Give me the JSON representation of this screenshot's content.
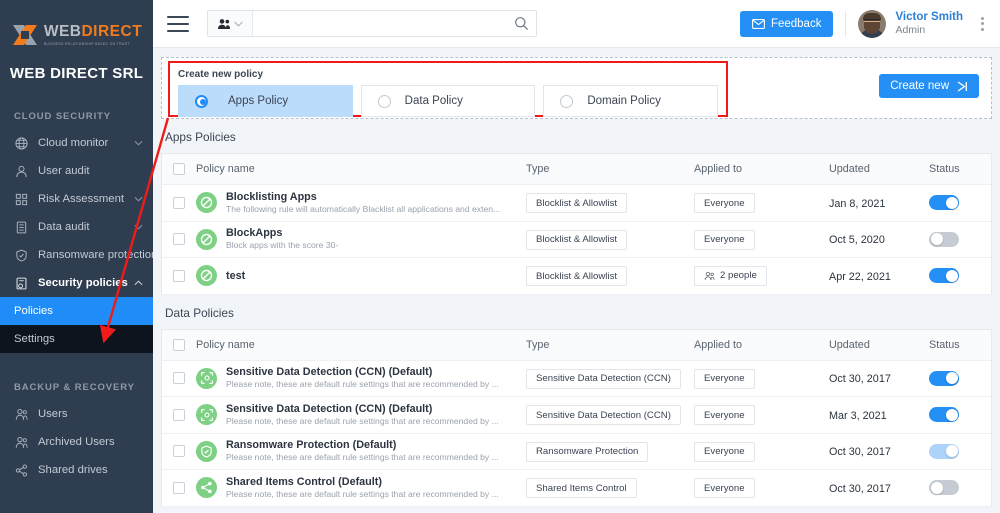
{
  "brand": {
    "logo_web": "WEB",
    "logo_direct": "DIRECT",
    "logo_tagline": "BUSINESS RELATIONSHIP BASED ON TRUST",
    "org_name": "WEB DIRECT SRL"
  },
  "sidebar": {
    "sections": [
      {
        "title": "CLOUD SECURITY",
        "items": [
          {
            "label": "Cloud monitor",
            "icon": "globe-icon",
            "chevron": "down",
            "state": "normal"
          },
          {
            "label": "User audit",
            "icon": "user-icon",
            "chevron": "",
            "state": "normal"
          },
          {
            "label": "Risk Assessment",
            "icon": "grid-icon",
            "chevron": "down",
            "state": "normal"
          },
          {
            "label": "Data audit",
            "icon": "database-icon",
            "chevron": "down",
            "state": "normal"
          },
          {
            "label": "Ransomware protection",
            "icon": "shield-icon",
            "chevron": "",
            "state": "normal"
          },
          {
            "label": "Security policies",
            "icon": "policy-icon",
            "chevron": "up",
            "state": "expanded"
          },
          {
            "label": "Policies",
            "icon": "",
            "chevron": "",
            "state": "selected"
          },
          {
            "label": "Settings",
            "icon": "",
            "chevron": "",
            "state": "subdark"
          }
        ]
      },
      {
        "title": "BACKUP & RECOVERY",
        "items": [
          {
            "label": "Users",
            "icon": "users-icon",
            "chevron": "",
            "state": "normal"
          },
          {
            "label": "Archived Users",
            "icon": "users-icon",
            "chevron": "",
            "state": "normal"
          },
          {
            "label": "Shared drives",
            "icon": "share-icon",
            "chevron": "",
            "state": "normal"
          }
        ]
      }
    ]
  },
  "topbar": {
    "menu_icon": "hamburger-icon",
    "search_scope_icon": "people-icon",
    "search_value": "",
    "search_placeholder": "",
    "search_icon": "search-icon",
    "feedback_label": "Feedback",
    "feedback_icon": "envelope-icon",
    "user_name": "Victor Smith",
    "user_role": "Admin",
    "overflow_icon": "kebab-menu-icon"
  },
  "create_panel": {
    "title": "Create new policy",
    "options": [
      {
        "label": "Apps Policy",
        "selected": true
      },
      {
        "label": "Data Policy",
        "selected": false
      },
      {
        "label": "Domain Policy",
        "selected": false
      }
    ],
    "create_button_label": "Create new",
    "create_button_icon": "arrow-right-icon",
    "highlight_color": "#ee1c19",
    "accent_color": "#2490f5"
  },
  "columns": {
    "policy_name": "Policy name",
    "type": "Type",
    "applied_to": "Applied to",
    "updated": "Updated",
    "status": "Status"
  },
  "apps_policies": {
    "section_title": "Apps Policies",
    "rows": [
      {
        "name": "Blocklisting Apps",
        "desc": "The following rule will automatically Blacklist all applications and exten...",
        "icon": "block-icon",
        "type": "Blocklist & Allowlist",
        "applied_to": "Everyone",
        "applied_icon": "",
        "updated": "Jan 8, 2021",
        "status": "on"
      },
      {
        "name": "BlockApps",
        "desc": "Block apps with the score 30-",
        "icon": "block-icon",
        "type": "Blocklist & Allowlist",
        "applied_to": "Everyone",
        "applied_icon": "",
        "updated": "Oct 5, 2020",
        "status": "off"
      },
      {
        "name": "test",
        "desc": "",
        "icon": "block-icon",
        "type": "Blocklist & Allowlist",
        "applied_to": "2 people",
        "applied_icon": "people-icon",
        "updated": "Apr 22, 2021",
        "status": "on"
      }
    ]
  },
  "data_policies": {
    "section_title": "Data Policies",
    "rows": [
      {
        "name": "Sensitive Data Detection (CCN) (Default)",
        "desc": "Please note, these are default rule settings that are recommended by ...",
        "icon": "scan-icon",
        "type": "Sensitive Data Detection (CCN)",
        "applied_to": "Everyone",
        "applied_icon": "",
        "updated": "Oct 30, 2017",
        "status": "on"
      },
      {
        "name": "Sensitive Data Detection (CCN) (Default)",
        "desc": "Please note, these are default rule settings that are recommended by ...",
        "icon": "scan-icon",
        "type": "Sensitive Data Detection (CCN)",
        "applied_to": "Everyone",
        "applied_icon": "",
        "updated": "Mar 3, 2021",
        "status": "on"
      },
      {
        "name": "Ransomware Protection (Default)",
        "desc": "Please note, these are default rule settings that are recommended by ...",
        "icon": "shield-check-icon",
        "type": "Ransomware Protection",
        "applied_to": "Everyone",
        "applied_icon": "",
        "updated": "Oct 30, 2017",
        "status": "dim"
      },
      {
        "name": "Shared Items Control (Default)",
        "desc": "Please note, these are default rule settings that are recommended by ...",
        "icon": "share-nodes-icon",
        "type": "Shared Items Control",
        "applied_to": "Everyone",
        "applied_icon": "",
        "updated": "Oct 30, 2017",
        "status": "off"
      }
    ]
  }
}
